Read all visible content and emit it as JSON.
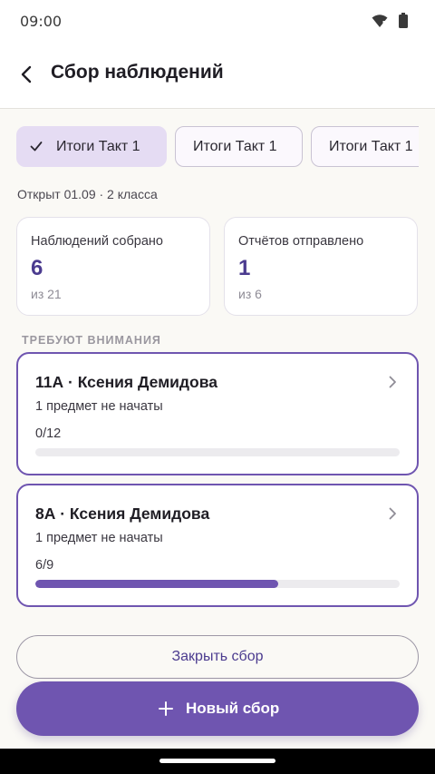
{
  "status_bar": {
    "time": "09:00",
    "icons": [
      "wifi-icon",
      "battery-icon"
    ]
  },
  "app_bar": {
    "back_icon": "arrow-back-icon",
    "title": "Сбор наблюдений"
  },
  "chips": [
    {
      "label": "Итоги Такт 1",
      "selected": true,
      "icon": "check-icon"
    },
    {
      "label": "Итоги Такт 1",
      "selected": false
    },
    {
      "label": "Итоги Такт 1",
      "selected": false
    }
  ],
  "meta_text": "Открыт 01.09 · 2 класса",
  "stats": [
    {
      "label": "Наблюдений собрано",
      "value": "6",
      "sub": "из 21"
    },
    {
      "label": "Отчётов отправлено",
      "value": "1",
      "sub": "из 6"
    }
  ],
  "section_label": "ТРЕБУЮТ ВНИМАНИЯ",
  "attention_items": [
    {
      "title": "11А · Ксения Демидова",
      "subject": "1 предмет не начаты",
      "count": "0/12",
      "progress": 0.0
    },
    {
      "title": "8А · Ксения Демидова",
      "subject": "1 предмет не начаты",
      "count": "6/9",
      "progress": 0.667
    }
  ],
  "close_button": "Закрыть сбор",
  "fab": {
    "label": "Новый сбор",
    "icon": "plus-icon"
  },
  "colors": {
    "accent": "#6f55b0",
    "accent_dark": "#4b3b8f",
    "chip_selected": "#e5dcf3",
    "background": "#faf9f5"
  }
}
